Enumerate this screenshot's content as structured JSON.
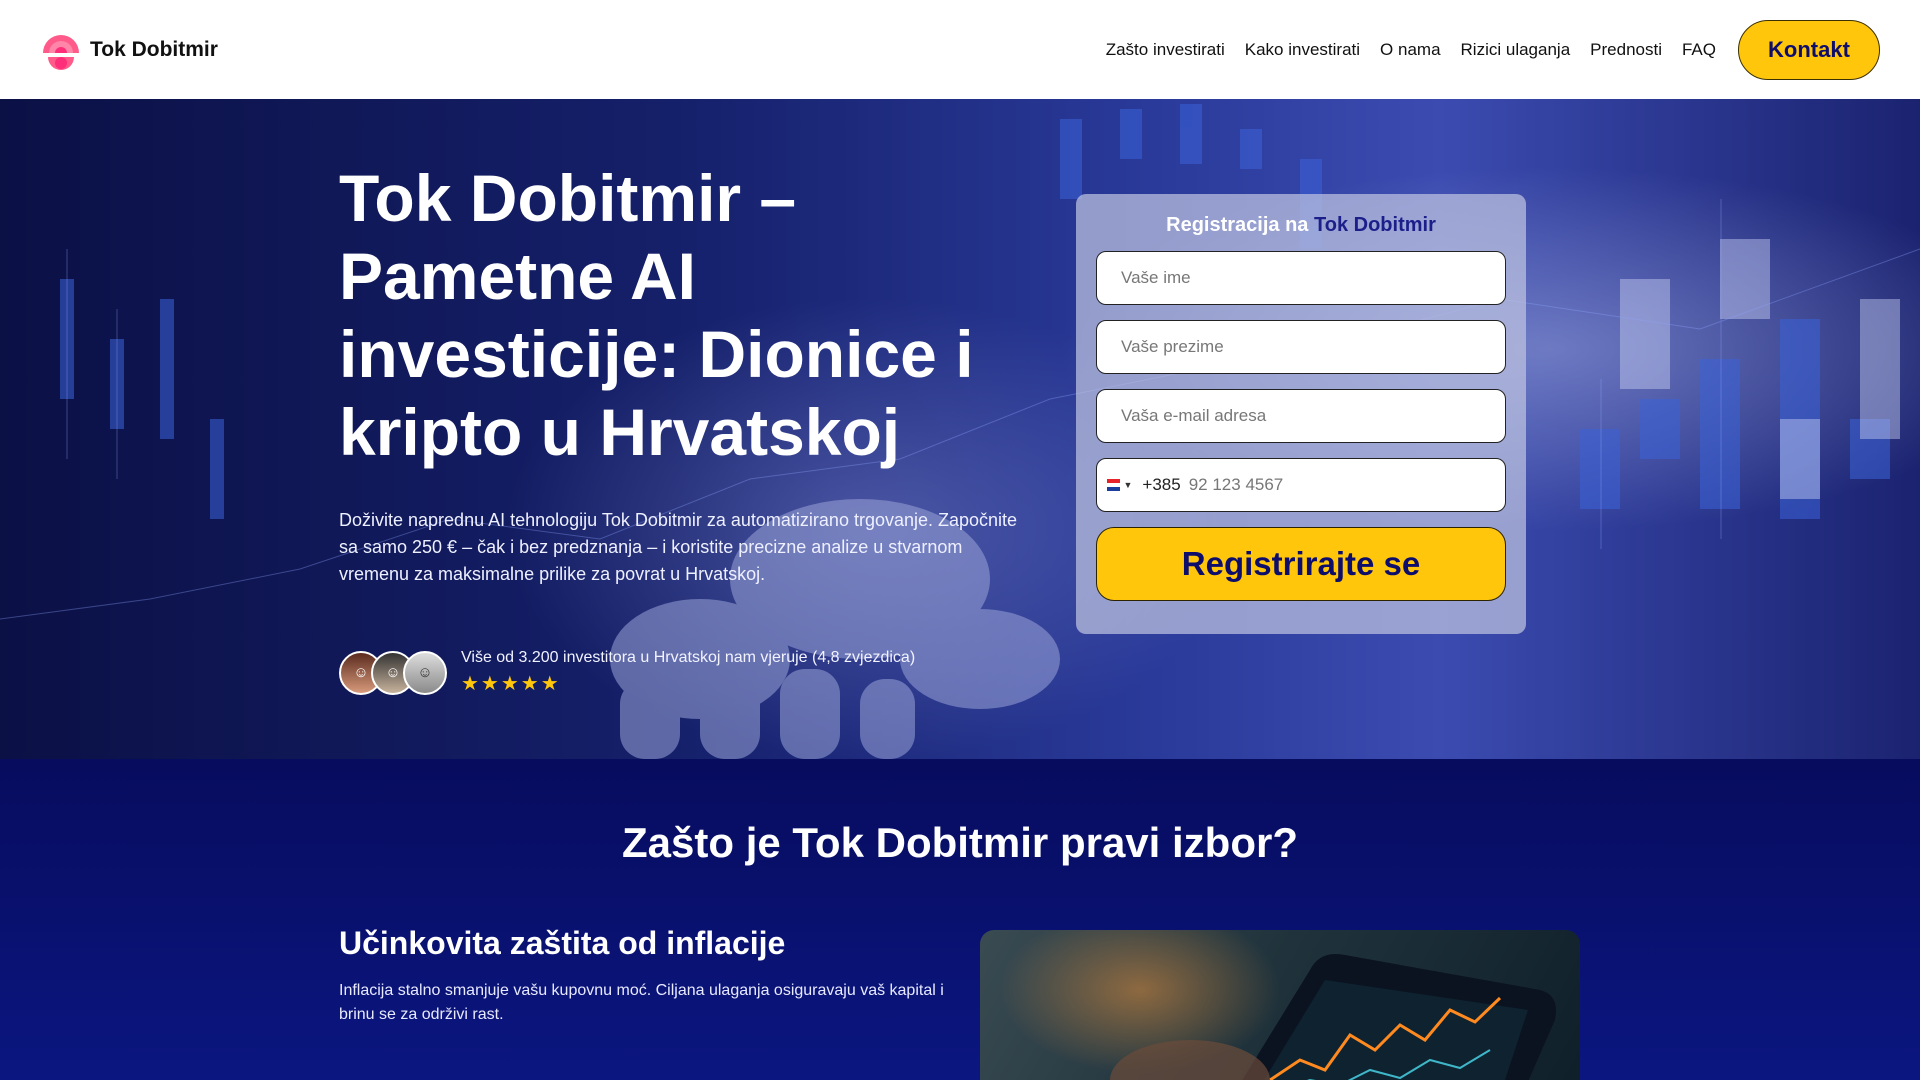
{
  "header": {
    "brand": "Tok Dobitmir",
    "nav": [
      "Zašto investirati",
      "Kako investirati",
      "O nama",
      "Rizici ulaganja",
      "Prednosti",
      "FAQ"
    ],
    "contact_label": "Kontakt"
  },
  "hero": {
    "title": "Tok Dobitmir – Pametne AI investicije: Dionice i kripto u Hrvatskoj",
    "description": "Doživite naprednu AI tehnologiju Tok Dobitmir za automatizirano trgovanje. Započnite sa samo 250 € – čak i bez predznanja – i koristite precizne analize u stvarnom vremenu za maksimalne prilike za povrat u Hrvatskoj.",
    "social_text": "Više od 3.200 investitora u Hrvatskoj nam vjeruje (4,8 zvjezdica)",
    "stars": "★★★★★"
  },
  "form": {
    "title_prefix": "Registracija na",
    "title_brand": "Tok Dobitmir",
    "first_name_placeholder": "Vaše ime",
    "last_name_placeholder": "Vaše prezime",
    "email_placeholder": "Vaša e-mail adresa",
    "phone_code": "+385",
    "phone_placeholder": "92 123 4567",
    "submit_label": "Registrirajte se"
  },
  "why": {
    "title": "Zašto je Tok Dobitmir pravi izbor?",
    "feature_title": "Učinkovita zaštita od inflacije",
    "feature_text": "Inflacija stalno smanjuje vašu kupovnu moć. Ciljana ulaganja osiguravaju vaš kapital i brinu se za održivi rast."
  },
  "colors": {
    "accent_yellow": "#ffc60c",
    "brand_navy": "#0d0d6b",
    "section_bg": "#0a0f6e"
  }
}
